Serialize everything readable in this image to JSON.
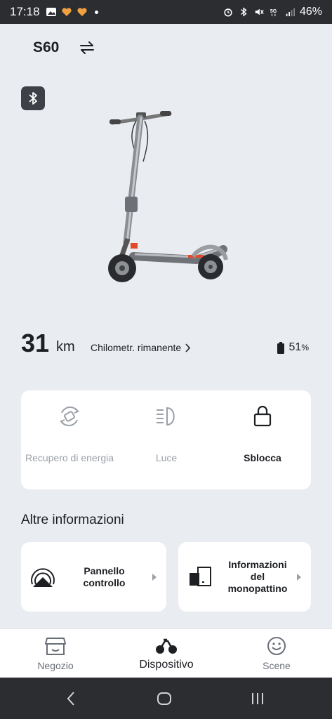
{
  "status_bar": {
    "time": "17:18",
    "battery_percent": "46%",
    "icons": [
      "gallery-icon",
      "heart-icon",
      "heart-icon",
      "alarm-icon",
      "bluetooth-icon",
      "mute-icon",
      "5g-icon",
      "signal-icon"
    ]
  },
  "header": {
    "model": "S60",
    "switch_icon": "swap-arrows-icon"
  },
  "device": {
    "bluetooth_icon": "bluetooth-icon",
    "image": "kick-scooter"
  },
  "range": {
    "value": "31",
    "unit": "km",
    "label": "Chilometr. rimanente",
    "battery": "51",
    "battery_unit": "%"
  },
  "controls": [
    {
      "label": "Recupero di energia",
      "icon": "energy-recovery-icon",
      "active": false
    },
    {
      "label": "Luce",
      "icon": "headlight-icon",
      "active": false
    },
    {
      "label": "Sblocca",
      "icon": "lock-icon",
      "active": true
    }
  ],
  "more_info": {
    "title": "Altre informazioni",
    "cards": [
      {
        "label_line1": "Pannello",
        "label_line2": "controllo",
        "label_line3": "",
        "icon": "dashboard-icon"
      },
      {
        "label_line1": "Informazioni",
        "label_line2": "del",
        "label_line3": "monopattino",
        "icon": "scooter-info-icon"
      }
    ]
  },
  "bottom_nav": [
    {
      "label": "Negozio",
      "icon": "shop-icon",
      "active": false
    },
    {
      "label": "Dispositivo",
      "icon": "bike-icon",
      "active": true
    },
    {
      "label": "Scene",
      "icon": "smiley-icon",
      "active": false
    }
  ],
  "colors": {
    "background": "#e9ecf0",
    "card": "#ffffff",
    "text": "#1d1f23",
    "muted": "#9aa0a8",
    "statusbar": "#2b2d31"
  }
}
